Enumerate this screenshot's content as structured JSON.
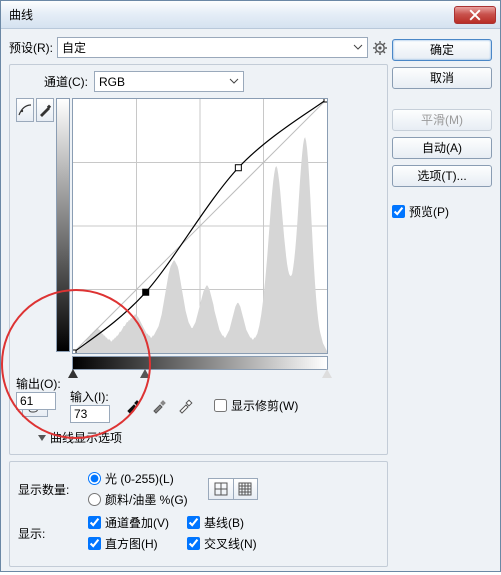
{
  "titlebar": {
    "title": "曲线"
  },
  "preset": {
    "label": "预设(R):",
    "value": "自定"
  },
  "channel": {
    "label": "通道(C):",
    "value": "RGB"
  },
  "output": {
    "label": "输出(O):",
    "value": "61"
  },
  "input": {
    "label": "输入(I):",
    "value": "73"
  },
  "show_clip": {
    "label": "显示修剪(W)"
  },
  "disclosure": {
    "label": "曲线显示选项"
  },
  "display_amount": {
    "label": "显示数量:",
    "light": "光 (0-255)(L)",
    "pigment": "颜料/油墨 %(G)"
  },
  "show": {
    "label": "显示:",
    "overlay": "通道叠加(V)",
    "baseline": "基线(B)",
    "histogram": "直方图(H)",
    "intersection": "交叉线(N)"
  },
  "buttons": {
    "ok": "确定",
    "cancel": "取消",
    "smooth": "平滑(M)",
    "auto": "自动(A)",
    "options": "选项(T)..."
  },
  "preview": {
    "label": "预览(P)"
  },
  "chart_data": {
    "type": "line",
    "title": "Curves",
    "xlabel": "Input",
    "ylabel": "Output",
    "xlim": [
      0,
      255
    ],
    "ylim": [
      0,
      255
    ],
    "control_points": [
      {
        "x": 0,
        "y": 0
      },
      {
        "x": 73,
        "y": 61
      },
      {
        "x": 166,
        "y": 186
      },
      {
        "x": 255,
        "y": 255
      }
    ],
    "histogram": [
      0,
      0,
      0,
      0,
      1,
      1,
      2,
      2,
      3,
      3,
      4,
      5,
      5,
      6,
      7,
      8,
      8,
      9,
      10,
      10,
      11,
      11,
      12,
      12,
      13,
      13,
      12,
      12,
      11,
      10,
      10,
      9,
      9,
      8,
      8,
      7,
      7,
      7,
      6,
      6,
      7,
      7,
      8,
      8,
      9,
      9,
      10,
      11,
      11,
      12,
      13,
      14,
      14,
      15,
      16,
      16,
      17,
      17,
      18,
      18,
      19,
      19,
      20,
      20,
      19,
      19,
      18,
      17,
      16,
      15,
      14,
      13,
      12,
      11,
      10,
      10,
      9,
      9,
      8,
      8,
      9,
      9,
      10,
      11,
      12,
      13,
      14,
      16,
      18,
      20,
      23,
      26,
      29,
      32,
      35,
      38,
      41,
      43,
      45,
      46,
      47,
      48,
      48,
      47,
      46,
      45,
      43,
      40,
      37,
      34,
      31,
      28,
      25,
      22,
      20,
      18,
      16,
      15,
      14,
      13,
      13,
      14,
      15,
      16,
      18,
      20,
      22,
      24,
      26,
      28,
      30,
      32,
      33,
      34,
      35,
      35,
      34,
      33,
      31,
      29,
      27,
      25,
      22,
      20,
      18,
      16,
      14,
      12,
      11,
      10,
      9,
      9,
      8,
      8,
      9,
      10,
      11,
      12,
      14,
      16,
      18,
      20,
      22,
      24,
      25,
      26,
      26,
      25,
      24,
      22,
      20,
      18,
      16,
      14,
      12,
      11,
      10,
      9,
      8,
      8,
      7,
      7,
      8,
      8,
      9,
      10,
      12,
      14,
      17,
      20,
      24,
      28,
      33,
      38,
      44,
      50,
      57,
      64,
      71,
      78,
      84,
      89,
      93,
      96,
      97,
      96,
      93,
      89,
      84,
      78,
      72,
      66,
      60,
      55,
      50,
      46,
      43,
      41,
      40,
      40,
      41,
      44,
      48,
      53,
      59,
      66,
      74,
      82,
      90,
      97,
      103,
      108,
      111,
      112,
      110,
      106,
      100,
      92,
      83,
      73,
      63,
      53,
      44,
      36,
      29,
      23,
      18,
      14,
      11,
      9,
      7,
      5,
      4,
      3,
      2,
      1
    ]
  }
}
